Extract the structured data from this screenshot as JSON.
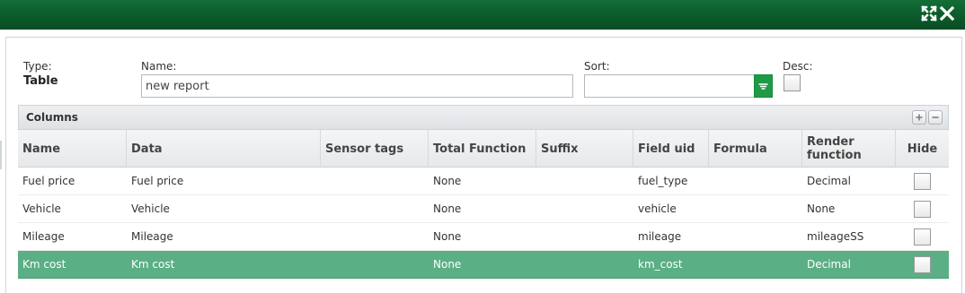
{
  "window": {
    "expand_icon": "expand-icon",
    "close_icon": "close-icon",
    "titlebar_color": "#0c5a2a"
  },
  "form": {
    "type_label": "Type:",
    "type_value": "Table",
    "name_label": "Name:",
    "name_value": "new report",
    "sort_label": "Sort:",
    "sort_value": "",
    "desc_label": "Desc:",
    "desc_checked": false
  },
  "grid": {
    "title": "Columns",
    "add_icon": "plus-icon",
    "remove_icon": "minus-icon",
    "headers": {
      "name": "Name",
      "data": "Data",
      "sensor_tags": "Sensor tags",
      "total_function": "Total Function",
      "suffix": "Suffix",
      "field_uid": "Field uid",
      "formula": "Formula",
      "render_function_line1": "Render",
      "render_function_line2": "function",
      "hide": "Hide"
    },
    "rows": [
      {
        "name": "Fuel price",
        "data": "Fuel price",
        "sensor_tags": "",
        "total_function": "None",
        "suffix": "",
        "field_uid": "fuel_type",
        "formula": "",
        "render_function": "Decimal",
        "hide": false,
        "selected": false
      },
      {
        "name": "Vehicle",
        "data": "Vehicle",
        "sensor_tags": "",
        "total_function": "None",
        "suffix": "",
        "field_uid": "vehicle",
        "formula": "",
        "render_function": "None",
        "hide": false,
        "selected": false
      },
      {
        "name": "Mileage",
        "data": "Mileage",
        "sensor_tags": "",
        "total_function": "None",
        "suffix": "",
        "field_uid": "mileage",
        "formula": "",
        "render_function": "mileageSS",
        "hide": false,
        "selected": false
      },
      {
        "name": "Km cost",
        "data": "Km cost",
        "sensor_tags": "",
        "total_function": "None",
        "suffix": "",
        "field_uid": "km_cost",
        "formula": "",
        "render_function": "Decimal",
        "hide": false,
        "selected": true
      }
    ],
    "selected_row_color": "#5aaf85"
  }
}
